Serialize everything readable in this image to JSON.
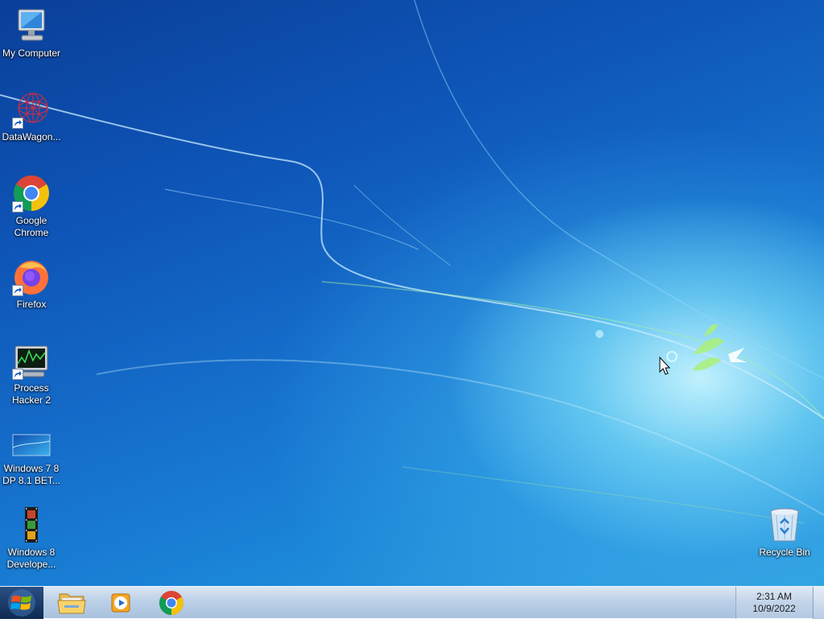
{
  "desktop": {
    "icons": [
      {
        "label": "My Computer",
        "icon": "computer-icon"
      },
      {
        "label": "DataWagon...",
        "icon": "datawagon-icon"
      },
      {
        "label": "Google Chrome",
        "icon": "chrome-icon"
      },
      {
        "label": "Firefox",
        "icon": "firefox-icon"
      },
      {
        "label": "Process Hacker 2",
        "icon": "process-hacker-icon"
      },
      {
        "label": "Windows 7 8 DP 8.1 BET...",
        "icon": "windows-screenshot-icon"
      },
      {
        "label": "Windows 8 Develope...",
        "icon": "film-strip-icon"
      },
      {
        "label": "Recycle Bin",
        "icon": "recycle-bin-icon"
      }
    ]
  },
  "taskbar": {
    "start_icon": "windows-logo-icon",
    "pinned": [
      {
        "name": "File Explorer",
        "icon": "folder-icon"
      },
      {
        "name": "Windows Media Player",
        "icon": "media-player-icon"
      },
      {
        "name": "Google Chrome",
        "icon": "chrome-icon"
      }
    ],
    "clock": {
      "time": "2:31 AM",
      "date": "10/9/2022"
    }
  },
  "colors": {
    "desktop_top": "#0a3f9a",
    "desktop_glow": "#c8f5ff",
    "taskbar": "#bcd0e7"
  }
}
